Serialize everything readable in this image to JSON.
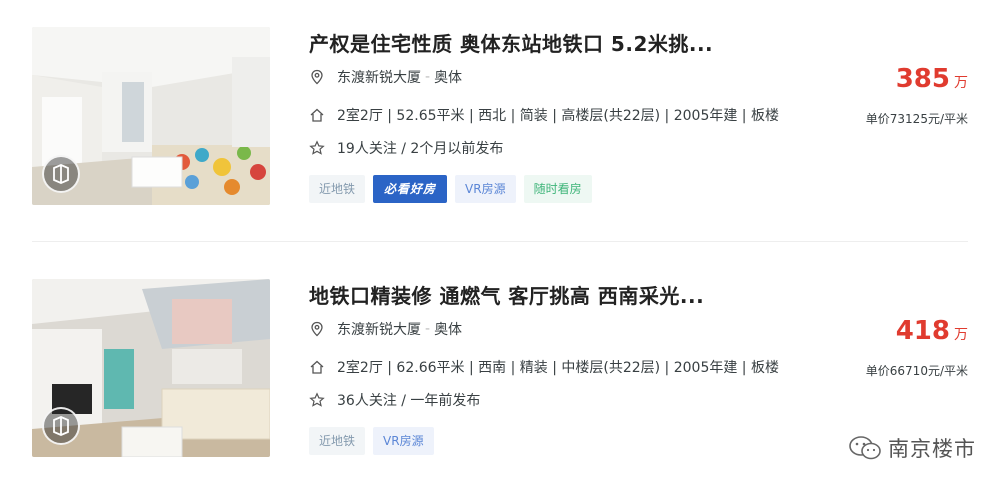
{
  "listings": [
    {
      "title": "产权是住宅性质 奥体东站地铁口 5.2米挑...",
      "community": "东渡新锐大厦",
      "area": "奥体",
      "info": [
        "2室2厅",
        "52.65平米",
        "西北",
        "简装",
        "高楼层(共22层)",
        "2005年建",
        "板楼"
      ],
      "follow": "19人关注 / 2个月以前发布",
      "tags": [
        "近地铁",
        "必看好房",
        "VR房源",
        "随时看房"
      ],
      "price": "385",
      "price_unit": "万",
      "unit_price": "单价73125元/平米"
    },
    {
      "title": "地铁口精装修 通燃气 客厅挑高 西南采光...",
      "community": "东渡新锐大厦",
      "area": "奥体",
      "info": [
        "2室2厅",
        "62.66平米",
        "西南",
        "精装",
        "中楼层(共22层)",
        "2005年建",
        "板楼"
      ],
      "follow": "36人关注 / 一年前发布",
      "tags": [
        "近地铁",
        "VR房源"
      ],
      "price": "418",
      "price_unit": "万",
      "unit_price": "单价66710元/平米"
    }
  ],
  "watermark": {
    "text": "南京楼市",
    "icon": "wechat-icon"
  },
  "colors": {
    "price": "#e03b2f",
    "must_see_tag": "#2b64c6",
    "vr_tag_text": "#5b86d6",
    "anytime_tag_text": "#3fb57a"
  }
}
